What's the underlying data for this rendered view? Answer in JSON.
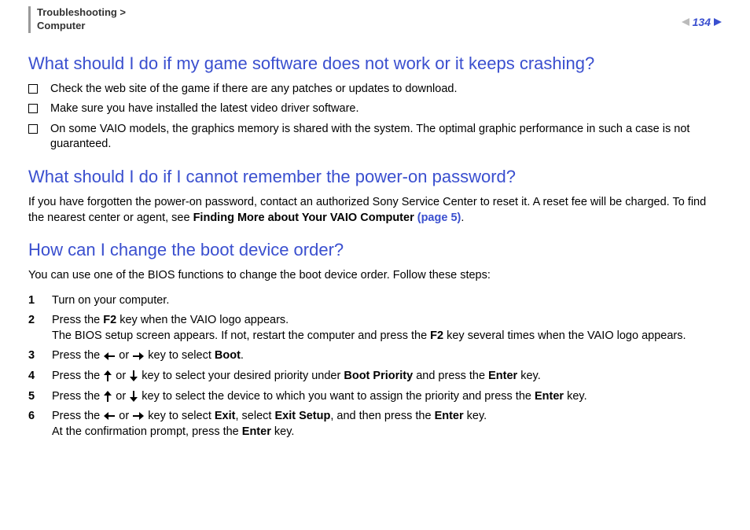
{
  "header": {
    "breadcrumb_line1": "Troubleshooting >",
    "breadcrumb_line2": "Computer",
    "page_number": "134"
  },
  "section1": {
    "heading": "What should I do if my game software does not work or it keeps crashing?",
    "bullets": [
      "Check the web site of the game if there are any patches or updates to download.",
      "Make sure you have installed the latest video driver software.",
      "On some VAIO models, the graphics memory is shared with the system. The optimal graphic performance in such a case is not guaranteed."
    ]
  },
  "section2": {
    "heading": "What should I do if I cannot remember the power-on password?",
    "para_pre": "If you have forgotten the power-on password, contact an authorized Sony Service Center to reset it. A reset fee will be charged. To find the nearest center or agent, see ",
    "para_bold": "Finding More about Your VAIO Computer ",
    "para_link": "(page 5)",
    "para_post": "."
  },
  "section3": {
    "heading": "How can I change the boot device order?",
    "intro": "You can use one of the BIOS functions to change the boot device order. Follow these steps:",
    "steps": {
      "s1": "Turn on your computer.",
      "s2a": "Press the ",
      "s2_f2": "F2",
      "s2b": " key when the VAIO logo appears.",
      "s2c": "The BIOS setup screen appears. If not, restart the computer and press the ",
      "s2d": " key several times when the VAIO logo appears.",
      "s3a": "Press the ",
      "s3_or": " or ",
      "s3b": " key to select ",
      "s3_boot": "Boot",
      "s4a": "Press the ",
      "s4b": " key to select your desired priority under ",
      "s4_bp": "Boot Priority",
      "s4c": " and press the ",
      "s4_enter": "Enter",
      "s4d": " key.",
      "s5a": "Press the ",
      "s5b": " key to select the device to which you want to assign the priority and press the ",
      "s5_enter": "Enter",
      "s5c": " key.",
      "s6a": "Press the ",
      "s6b": " key to select ",
      "s6_exit": "Exit",
      "s6c": ", select ",
      "s6_exitsetup": "Exit Setup",
      "s6d": ", and then press the ",
      "s6_enter": "Enter",
      "s6e": " key.",
      "s6f": "At the confirmation prompt, press the ",
      "s6g": " key."
    }
  }
}
